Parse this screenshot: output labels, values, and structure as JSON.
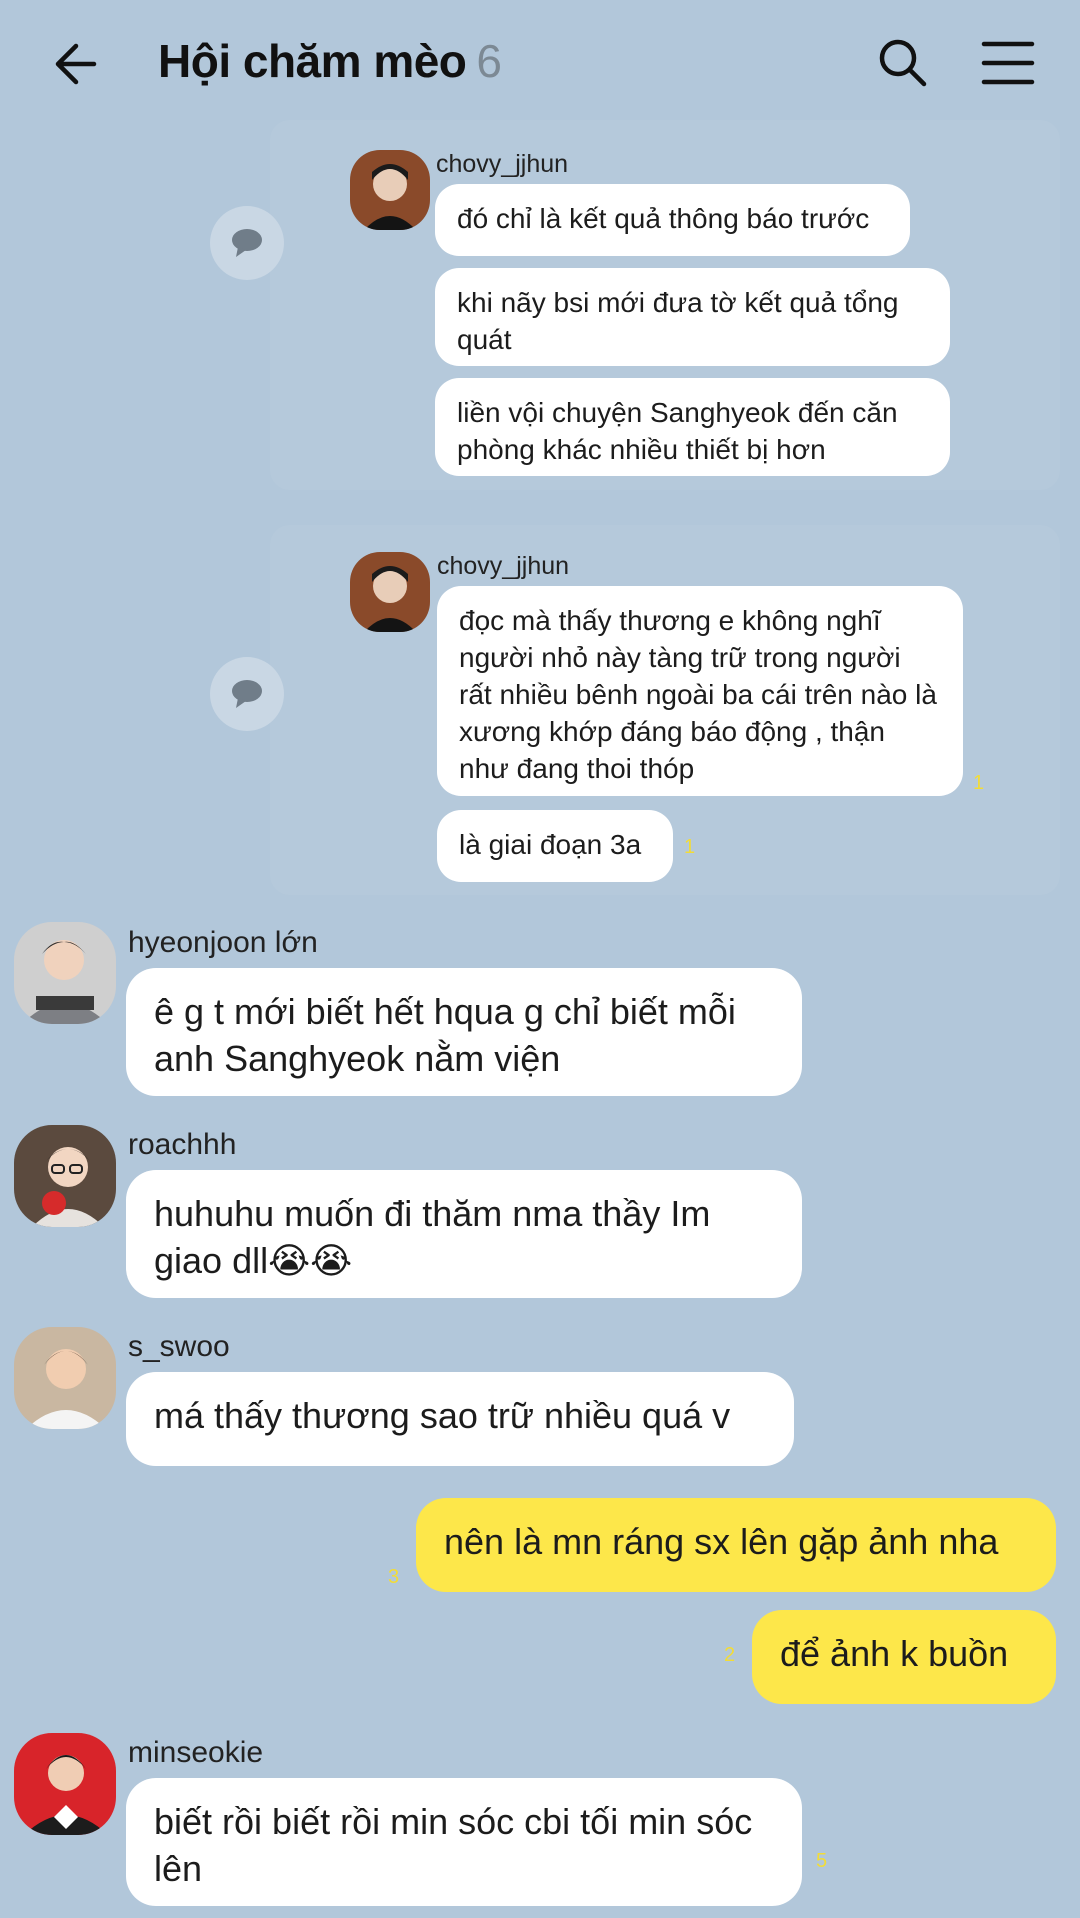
{
  "header": {
    "title": "Hội chăm mèo",
    "member_count": "6"
  },
  "colors": {
    "background": "#b2c7da",
    "my_bubble": "#fde74a",
    "their_bubble": "#ffffff",
    "read_count": "#f2dc38"
  },
  "messages": [
    {
      "sender": "chovy_jjhun",
      "bubbles": [
        "đó chỉ là kết quả thông báo trước",
        "khi nãy bsi mới đưa tờ kết quả tổng quát",
        "liền vội chuyện Sanghyeok đến căn phòng khác nhiều thiết bị hơn"
      ]
    },
    {
      "sender": "chovy_jjhun",
      "bubbles": [
        "đọc mà thấy thương e không nghĩ người nhỏ này tàng trữ trong người rất nhiều bênh ngoài ba cái trên nào là xương khớp đáng báo động , thận như đang thoi thóp",
        "là giai đoạn 3a"
      ],
      "read_counts": [
        "1",
        "1"
      ]
    },
    {
      "sender": "hyeonjoon lớn",
      "bubbles": [
        "ê g t mới biết hết hqua g chỉ biết mỗi anh Sanghyeok nằm viện"
      ]
    },
    {
      "sender": "roachhh",
      "bubbles": [
        "huhuhu muốn đi thăm nma thầy Im giao dll😭😭"
      ]
    },
    {
      "sender": "s_swoo",
      "bubbles": [
        "má thấy thương sao trữ nhiều quá v"
      ]
    },
    {
      "sender": "me",
      "bubbles": [
        "nên là mn ráng sx lên gặp ảnh nha",
        "để ảnh k buồn"
      ],
      "read_counts": [
        "3",
        "2"
      ]
    },
    {
      "sender": "minseokie",
      "bubbles": [
        "biết rồi biết rồi min sóc cbi tối min sóc lên"
      ],
      "read_counts": [
        "5"
      ]
    }
  ]
}
